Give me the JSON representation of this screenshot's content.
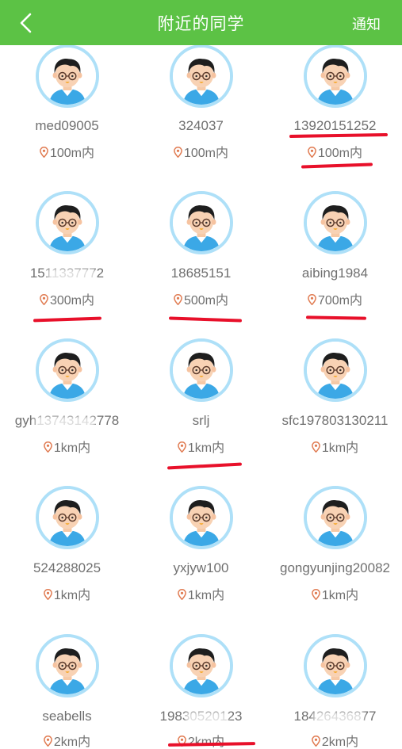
{
  "header": {
    "title": "附近的同学",
    "notice_label": "通知",
    "back_icon": "chevron-left-icon",
    "bg_color": "#5cc245"
  },
  "users": [
    {
      "name": "med09005",
      "distance": "100m内"
    },
    {
      "name": "324037",
      "distance": "100m内"
    },
    {
      "name": "13920151252",
      "distance": "100m内"
    },
    {
      "name": "1511337772",
      "distance": "300m内"
    },
    {
      "name": "18685151",
      "distance": "500m内"
    },
    {
      "name": "aibing1984",
      "distance": "700m内"
    },
    {
      "name": "gyh13743142778",
      "distance": "1km内"
    },
    {
      "name": "srlj",
      "distance": "1km内"
    },
    {
      "name": "sfc197803130211",
      "distance": "1km内"
    },
    {
      "name": "524288025",
      "distance": "1km内"
    },
    {
      "name": "yxjyw100",
      "distance": "1km内"
    },
    {
      "name": "gongyunjing20082",
      "distance": "1km内"
    },
    {
      "name": "seabells",
      "distance": "2km内"
    },
    {
      "name": "19830520123",
      "distance": "2km内"
    },
    {
      "name": "18426436877",
      "distance": "2km内"
    }
  ],
  "icons": {
    "avatar": "boy-avatar-icon",
    "location": "location-pin-icon"
  },
  "colors": {
    "annotation_red": "#e8102a",
    "pin": "#e07a50",
    "avatar_ring": "#aee0f8"
  }
}
